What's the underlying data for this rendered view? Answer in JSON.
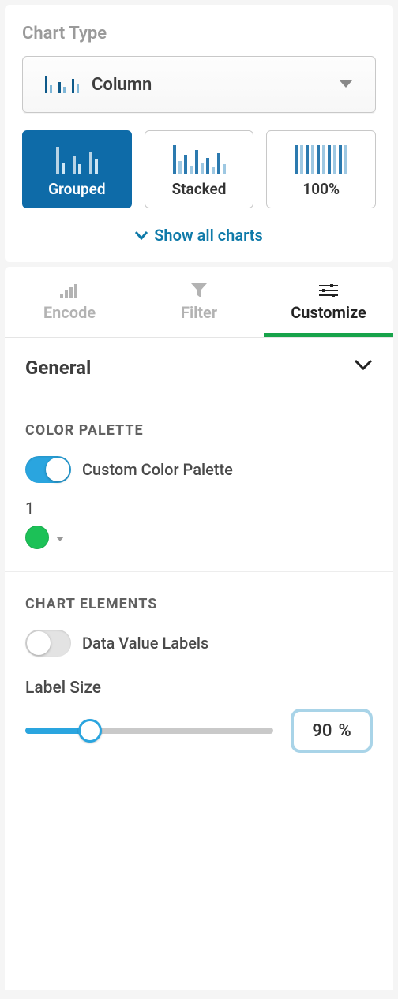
{
  "chart_type": {
    "label": "Chart Type",
    "selected": "Column",
    "subtypes": [
      {
        "label": "Grouped",
        "active": true
      },
      {
        "label": "Stacked",
        "active": false
      },
      {
        "label": "100%",
        "active": false
      }
    ],
    "show_all": "Show all charts"
  },
  "tabs": {
    "encode": "Encode",
    "filter": "Filter",
    "customize": "Customize"
  },
  "accordion": {
    "general": "General"
  },
  "color_palette": {
    "heading": "Color Palette",
    "toggle_label": "Custom Color Palette",
    "toggle_on": true,
    "swatch_index": "1",
    "swatch_color": "#1cc157"
  },
  "chart_elements": {
    "heading": "Chart Elements",
    "data_labels_label": "Data Value Labels",
    "data_labels_on": false,
    "label_size_label": "Label Size",
    "label_size_value": "90",
    "label_size_unit": "%"
  }
}
